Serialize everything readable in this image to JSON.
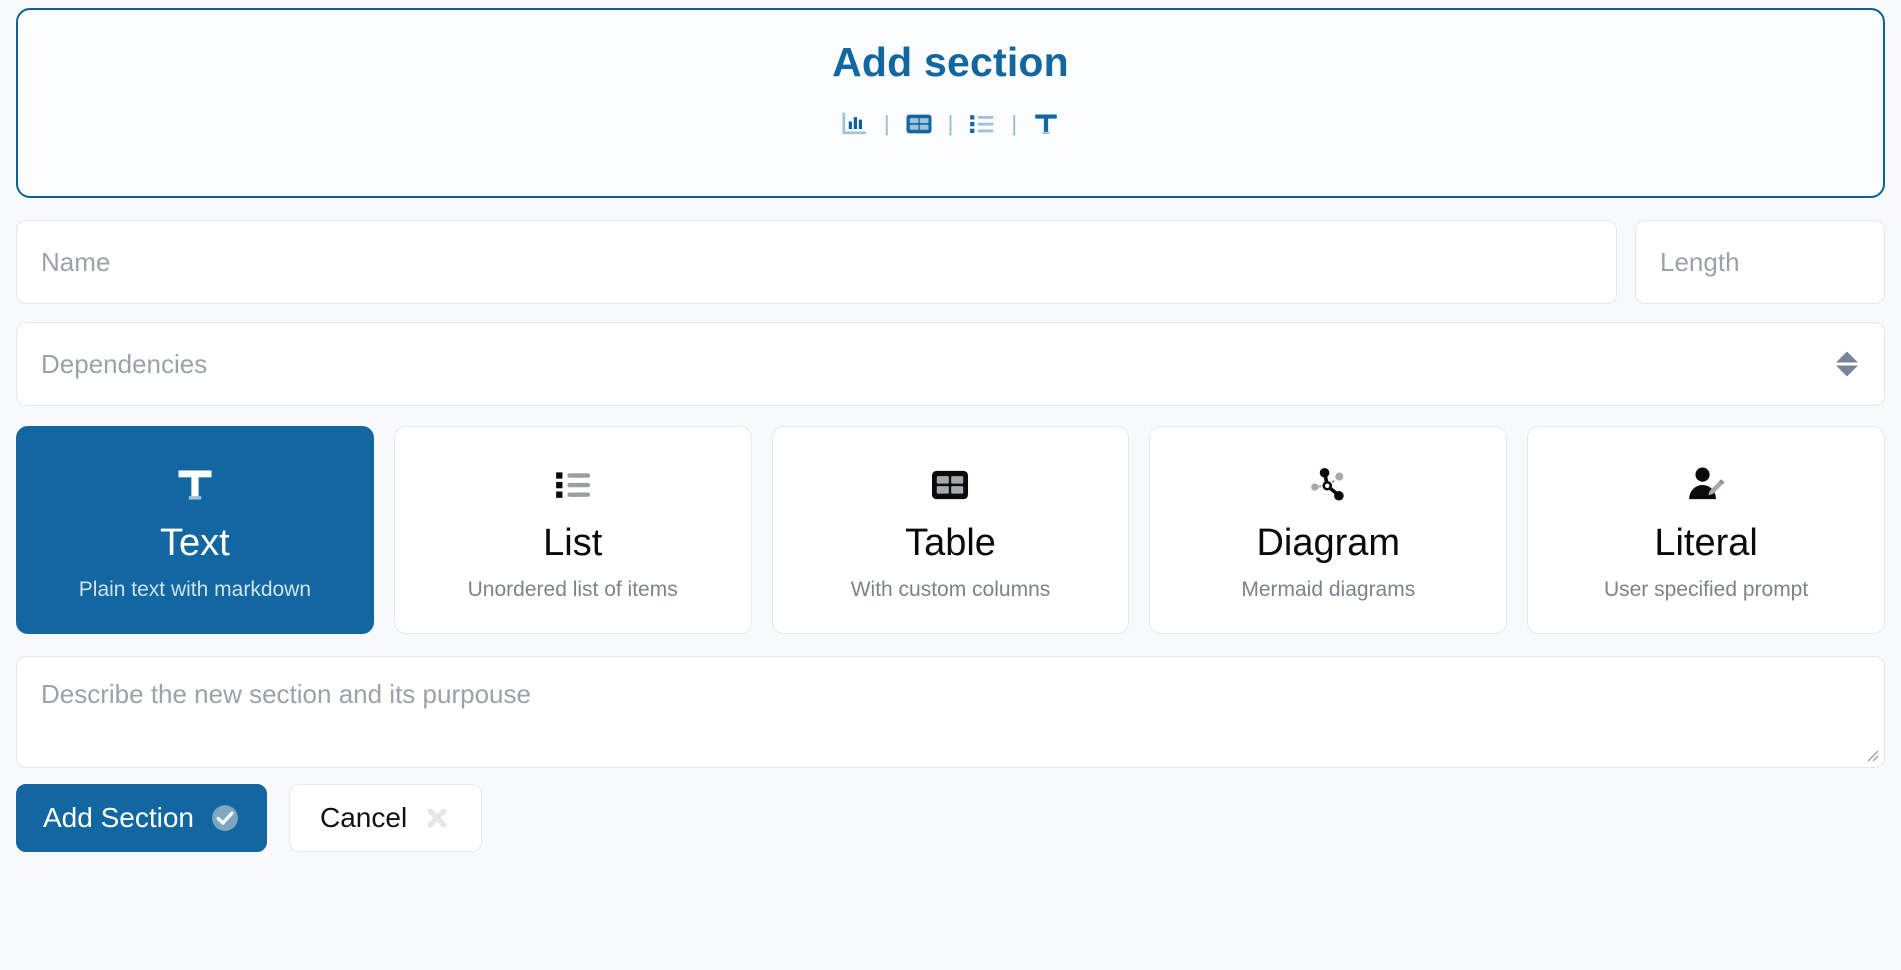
{
  "header": {
    "title": "Add section",
    "icons": [
      {
        "name": "bar-chart-icon",
        "glyph": "chart"
      },
      {
        "name": "separator",
        "glyph": "|"
      },
      {
        "name": "table-icon",
        "glyph": "table"
      },
      {
        "name": "separator",
        "glyph": "|"
      },
      {
        "name": "list-icon",
        "glyph": "list"
      },
      {
        "name": "separator",
        "glyph": "|"
      },
      {
        "name": "text-icon",
        "glyph": "T"
      }
    ],
    "separator": "|",
    "border_color": "#0e6198",
    "title_color": "#1267a0"
  },
  "fields": {
    "name_placeholder": "Name",
    "length_placeholder": "Length",
    "dependencies_placeholder": "Dependencies"
  },
  "section_types": [
    {
      "id": "text",
      "title": "Text",
      "description": "Plain text with markdown",
      "icon": "text-t-icon",
      "selected": true
    },
    {
      "id": "list",
      "title": "List",
      "description": "Unordered list of items",
      "icon": "bulleted-list-icon",
      "selected": false
    },
    {
      "id": "table",
      "title": "Table",
      "description": "With custom columns",
      "icon": "table-grid-icon",
      "selected": false
    },
    {
      "id": "diagram",
      "title": "Diagram",
      "description": "Mermaid diagrams",
      "icon": "node-graph-icon",
      "selected": false
    },
    {
      "id": "literal",
      "title": "Literal",
      "description": "User specified prompt",
      "icon": "user-edit-icon",
      "selected": false
    }
  ],
  "describe": {
    "placeholder": "Describe the new section and its purpouse",
    "value": ""
  },
  "actions": {
    "submit_label": "Add Section",
    "submit_icon": "check-circle-icon",
    "cancel_label": "Cancel",
    "cancel_icon": "close-x-icon"
  },
  "colors": {
    "accent": "#1267a0",
    "page_background": "#f7f9fb",
    "card_border": "#e7eaed",
    "placeholder_text": "#9aa2ab"
  }
}
